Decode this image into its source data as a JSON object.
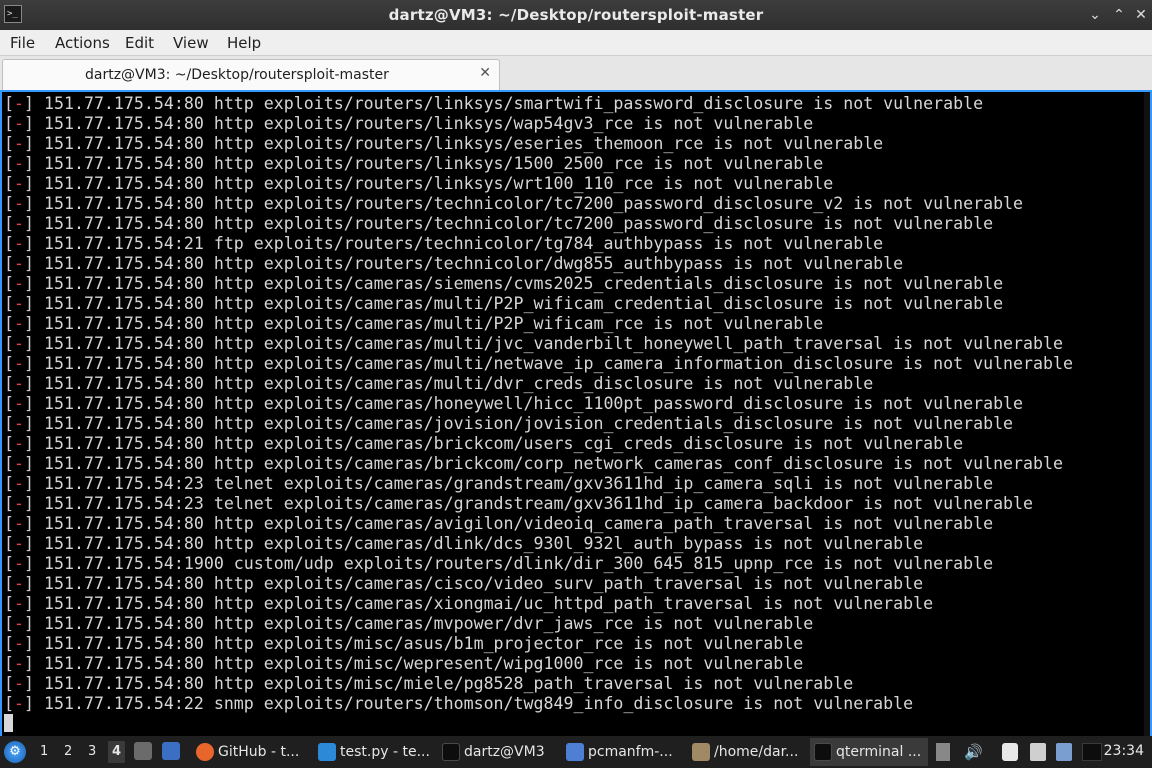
{
  "window": {
    "title": "dartz@VM3: ~/Desktop/routersploit-master",
    "app_icon_glyph": ">_",
    "minimize_glyph": "⌄",
    "maximize_glyph": "⌃",
    "close_glyph": "✕"
  },
  "menu": [
    "File",
    "Actions",
    "Edit",
    "View",
    "Help"
  ],
  "tab": {
    "label": "dartz@VM3: ~/Desktop/routersploit-master",
    "close_glyph": "✕"
  },
  "terminal": {
    "prefix_open": "[",
    "prefix_dash": "-",
    "prefix_close": "]",
    "lines": [
      " 151.77.175.54:80 http exploits/routers/linksys/smartwifi_password_disclosure is not vulnerable",
      " 151.77.175.54:80 http exploits/routers/linksys/wap54gv3_rce is not vulnerable",
      " 151.77.175.54:80 http exploits/routers/linksys/eseries_themoon_rce is not vulnerable",
      " 151.77.175.54:80 http exploits/routers/linksys/1500_2500_rce is not vulnerable",
      " 151.77.175.54:80 http exploits/routers/linksys/wrt100_110_rce is not vulnerable",
      " 151.77.175.54:80 http exploits/routers/technicolor/tc7200_password_disclosure_v2 is not vulnerable",
      " 151.77.175.54:80 http exploits/routers/technicolor/tc7200_password_disclosure is not vulnerable",
      " 151.77.175.54:21 ftp exploits/routers/technicolor/tg784_authbypass is not vulnerable",
      " 151.77.175.54:80 http exploits/routers/technicolor/dwg855_authbypass is not vulnerable",
      " 151.77.175.54:80 http exploits/cameras/siemens/cvms2025_credentials_disclosure is not vulnerable",
      " 151.77.175.54:80 http exploits/cameras/multi/P2P_wificam_credential_disclosure is not vulnerable",
      " 151.77.175.54:80 http exploits/cameras/multi/P2P_wificam_rce is not vulnerable",
      " 151.77.175.54:80 http exploits/cameras/multi/jvc_vanderbilt_honeywell_path_traversal is not vulnerable",
      " 151.77.175.54:80 http exploits/cameras/multi/netwave_ip_camera_information_disclosure is not vulnerable",
      " 151.77.175.54:80 http exploits/cameras/multi/dvr_creds_disclosure is not vulnerable",
      " 151.77.175.54:80 http exploits/cameras/honeywell/hicc_1100pt_password_disclosure is not vulnerable",
      " 151.77.175.54:80 http exploits/cameras/jovision/jovision_credentials_disclosure is not vulnerable",
      " 151.77.175.54:80 http exploits/cameras/brickcom/users_cgi_creds_disclosure is not vulnerable",
      " 151.77.175.54:80 http exploits/cameras/brickcom/corp_network_cameras_conf_disclosure is not vulnerable",
      " 151.77.175.54:23 telnet exploits/cameras/grandstream/gxv3611hd_ip_camera_sqli is not vulnerable",
      " 151.77.175.54:23 telnet exploits/cameras/grandstream/gxv3611hd_ip_camera_backdoor is not vulnerable",
      " 151.77.175.54:80 http exploits/cameras/avigilon/videoiq_camera_path_traversal is not vulnerable",
      " 151.77.175.54:80 http exploits/cameras/dlink/dcs_930l_932l_auth_bypass is not vulnerable",
      " 151.77.175.54:1900 custom/udp exploits/routers/dlink/dir_300_645_815_upnp_rce is not vulnerable",
      " 151.77.175.54:80 http exploits/cameras/cisco/video_surv_path_traversal is not vulnerable",
      " 151.77.175.54:80 http exploits/cameras/xiongmai/uc_httpd_path_traversal is not vulnerable",
      " 151.77.175.54:80 http exploits/cameras/mvpower/dvr_jaws_rce is not vulnerable",
      " 151.77.175.54:80 http exploits/misc/asus/b1m_projector_rce is not vulnerable",
      " 151.77.175.54:80 http exploits/misc/wepresent/wipg1000_rce is not vulnerable",
      " 151.77.175.54:80 http exploits/misc/miele/pg8528_path_traversal is not vulnerable",
      " 151.77.175.54:22 snmp exploits/routers/thomson/twg849_info_disclosure is not vulnerable"
    ]
  },
  "taskbar": {
    "start_icon": "start-menu-icon",
    "workspaces": [
      "1",
      "2",
      "3",
      "4"
    ],
    "active_workspace": "4",
    "tasks": [
      {
        "label": "GitHub - t...",
        "icon": "firefox-icon",
        "color": "#e8662b"
      },
      {
        "label": "test.py - te...",
        "icon": "vscode-icon",
        "color": "#2a8ad8"
      },
      {
        "label": "dartz@VM3",
        "icon": "terminal-icon",
        "color": "#0d0d0d"
      },
      {
        "label": "pcmanfm-...",
        "icon": "folder-icon",
        "color": "#4f7fd4"
      },
      {
        "label": "/home/dar...",
        "icon": "archive-icon",
        "color": "#a08a66"
      },
      {
        "label": "qterminal ...",
        "icon": "terminal-icon",
        "color": "#0d0d0d"
      }
    ],
    "clock": "23:34"
  }
}
